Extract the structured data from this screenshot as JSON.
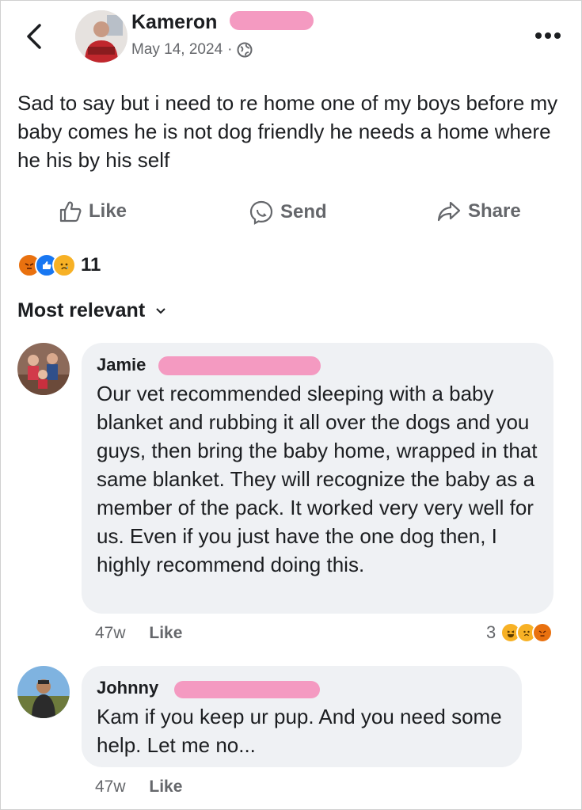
{
  "post": {
    "author": "Kameron",
    "date": "May 14, 2024",
    "separator": "·",
    "text": "Sad to say but i need to re home one of my boys before my baby comes he is not dog friendly he needs a home where he his by his self",
    "reaction_count": "11"
  },
  "actions": {
    "like": "Like",
    "send": "Send",
    "share": "Share"
  },
  "sort_label": "Most relevant",
  "comments": [
    {
      "name": "Jamie",
      "text": "Our vet recommended sleeping with a baby blanket and rubbing it all over the dogs and you guys, then bring the baby home, wrapped in that same blanket. They will recognize the baby as a member of the pack. It worked very very well for us. Even if you just have the one dog then, I highly recommend doing this.",
      "time": "47w",
      "like": "Like",
      "reaction_count": "3"
    },
    {
      "name": "Johnny",
      "text": "Kam if you keep ur pup. And you need some help. Let me no...",
      "time": "47w",
      "like": "Like"
    }
  ],
  "colors": {
    "text": "#1c1e21",
    "secondary": "#65676b",
    "bubble": "#eff1f4",
    "redaction": "#f49ac1"
  }
}
